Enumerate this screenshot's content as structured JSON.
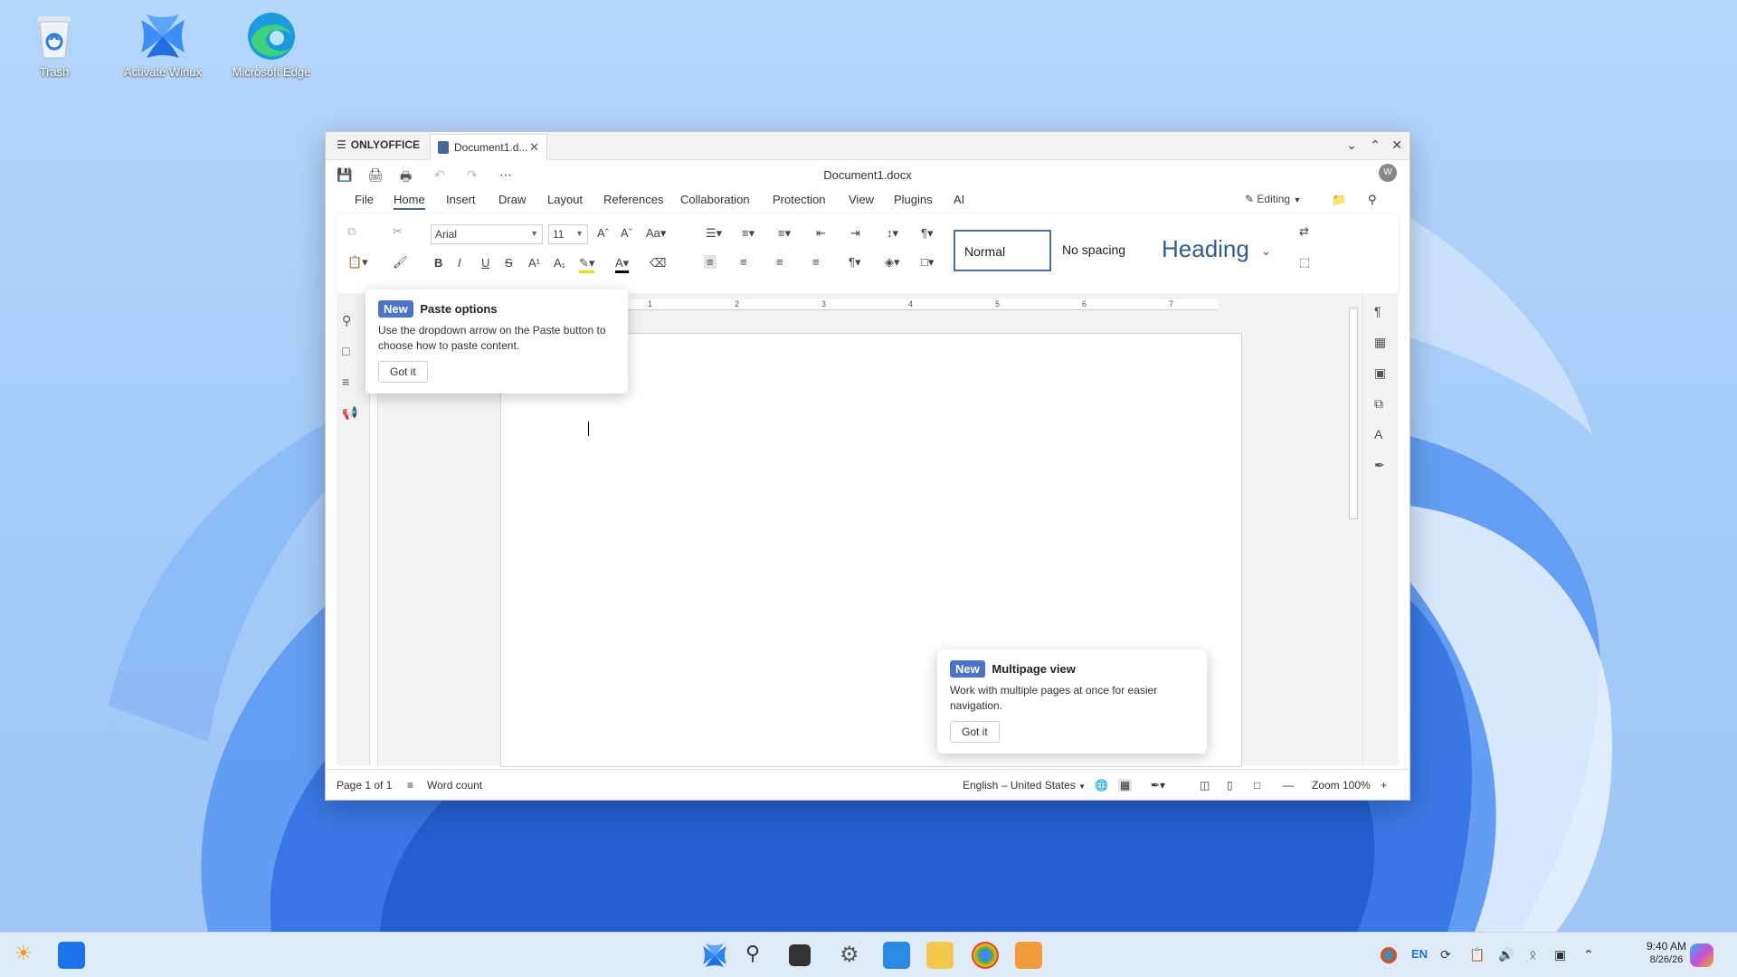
{
  "desktop": {
    "icons": [
      {
        "label": "Trash"
      },
      {
        "label": "Activate Winux"
      },
      {
        "label": "Microsoft Edge"
      }
    ]
  },
  "window": {
    "app_name": "ONLYOFFICE",
    "tab_title": "Document1.d...",
    "doc_title": "Document1.docx",
    "avatar": "W",
    "menu": [
      "File",
      "Home",
      "Insert",
      "Draw",
      "Layout",
      "References",
      "Collaboration",
      "Protection",
      "View",
      "Plugins",
      "AI"
    ],
    "active_menu": "Home",
    "editing_label": "Editing",
    "font_name": "Arial",
    "font_size": "11",
    "styles": [
      "Normal",
      "No spacing",
      "Heading"
    ],
    "ruler_numbers": [
      "1",
      "2",
      "3",
      "4",
      "5",
      "6",
      "7"
    ]
  },
  "popover_paste": {
    "badge": "New",
    "title": "Paste options",
    "desc": "Use the dropdown arrow on the Paste button to choose how to paste content.",
    "button": "Got it"
  },
  "popover_multipage": {
    "badge": "New",
    "title": "Multipage view",
    "desc": "Work with multiple pages at once for easier navigation.",
    "button": "Got it"
  },
  "statusbar": {
    "page": "Page 1 of 1",
    "word_count": "Word count",
    "language": "English – United States",
    "zoom": "Zoom 100%"
  },
  "taskbar": {
    "lang": "EN",
    "time": "9:40 AM",
    "date": "8/26/26"
  }
}
